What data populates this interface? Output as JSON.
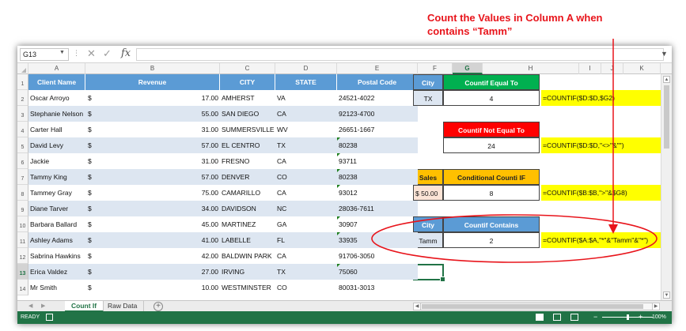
{
  "callout": {
    "line1": "Count the Values in Column A when",
    "line2": "contains “Tamm”"
  },
  "formula_bar": {
    "name_box": "G13",
    "formula": ""
  },
  "columns": [
    "A",
    "B",
    "C",
    "D",
    "E",
    "F",
    "G",
    "H",
    "I",
    "J",
    "K"
  ],
  "rows": [
    "1",
    "2",
    "3",
    "4",
    "5",
    "6",
    "7",
    "8",
    "9",
    "10",
    "11",
    "12",
    "13",
    "14"
  ],
  "active_cell": {
    "column": "G",
    "row": "13"
  },
  "table": {
    "headers": [
      "Client Name",
      "Revenue",
      "CITY",
      "STATE",
      "Postal Code"
    ],
    "currency_symbol": "$",
    "records": [
      {
        "name": "Oscar Arroyo",
        "revenue": "17.00",
        "city": "AMHERST",
        "state": "VA",
        "postal": "24521-4022"
      },
      {
        "name": "Stephanie Nelson",
        "revenue": "55.00",
        "city": "SAN DIEGO",
        "state": "CA",
        "postal": "92123-4700"
      },
      {
        "name": "Carter Hall",
        "revenue": "31.00",
        "city": "SUMMERSVILLE",
        "state": "WV",
        "postal": "26651-1667"
      },
      {
        "name": "David Levy",
        "revenue": "57.00",
        "city": "EL CENTRO",
        "state": "TX",
        "postal": "80238"
      },
      {
        "name": "Jackie",
        "revenue": "31.00",
        "city": "FRESNO",
        "state": "CA",
        "postal": "93711"
      },
      {
        "name": "Tammy King",
        "revenue": "57.00",
        "city": "DENVER",
        "state": "CO",
        "postal": "80238"
      },
      {
        "name": "Tammey Gray",
        "revenue": "75.00",
        "city": "CAMARILLO",
        "state": "CA",
        "postal": "93012"
      },
      {
        "name": "Diane Tarver",
        "revenue": "34.00",
        "city": "DAVIDSON",
        "state": "NC",
        "postal": "28036-7611"
      },
      {
        "name": "Barbara Ballard",
        "revenue": "45.00",
        "city": "MARTINEZ",
        "state": "GA",
        "postal": "30907"
      },
      {
        "name": "Ashley Adams",
        "revenue": "41.00",
        "city": "LABELLE",
        "state": "FL",
        "postal": "33935"
      },
      {
        "name": "Sabrina Hawkins",
        "revenue": "42.00",
        "city": "BALDWIN PARK",
        "state": "CA",
        "postal": "91706-3050"
      },
      {
        "name": "Erica Valdez",
        "revenue": "27.00",
        "city": "IRVING",
        "state": "TX",
        "postal": "75060"
      },
      {
        "name": "Mr Smith",
        "revenue": "10.00",
        "city": "WESTMINSTER",
        "state": "CO",
        "postal": "80031-3013"
      }
    ]
  },
  "examples": {
    "equal": {
      "label": "City",
      "criteria": "TX",
      "title": "Countif Equal To",
      "result": "4",
      "formula": "=COUNTIF($D:$D,$G2)"
    },
    "not_equal": {
      "title": "Countif Not Equal To",
      "result": "24",
      "formula": "=COUNTIF($D:$D,\"<>\"&\"\")"
    },
    "conditional": {
      "label": "Sales",
      "currency": "$",
      "criteria": "50.00",
      "title": "Conditional Counti IF",
      "result": "8",
      "formula": "=COUNTIF($B:$B,\">\"&$G8)"
    },
    "contains": {
      "label": "City",
      "criteria": "Tamm",
      "title": "Countif Contains",
      "result": "2",
      "formula": "=COUNTIF($A:$A,\"*\"&\"Tamm\"&\"*\")"
    }
  },
  "sheet_tabs": [
    {
      "label": "Count If",
      "active": true
    },
    {
      "label": "Raw Data",
      "active": false
    }
  ],
  "add_sheet_symbol": "+",
  "status": {
    "mode": "READY",
    "zoom": "100%",
    "zoom_minus": "−",
    "zoom_plus": "+"
  },
  "colors": {
    "excel_green": "#217346",
    "header_blue": "#5b9bd5",
    "band_blue": "#dde6f1",
    "callout_red": "#e8141b",
    "highlight_yellow": "#ffff00"
  },
  "icons": {
    "cancel": "close-icon",
    "enter": "check-icon",
    "function": "fx-icon"
  }
}
